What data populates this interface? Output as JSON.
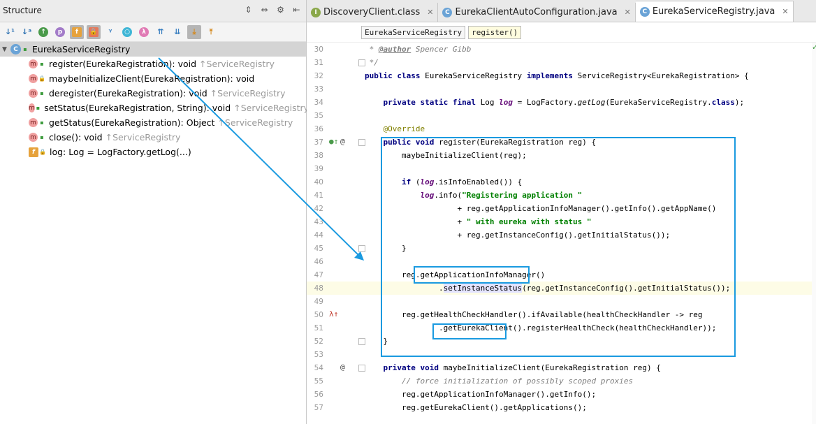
{
  "structure": {
    "title": "Structure",
    "root": "EurekaServiceRegistry",
    "items": [
      {
        "label": "register(EurekaRegistration): void",
        "inherited": "↑ServiceRegistry",
        "vis": "public",
        "kind": "method"
      },
      {
        "label": "maybeInitializeClient(EurekaRegistration): void",
        "inherited": "",
        "vis": "private",
        "kind": "method"
      },
      {
        "label": "deregister(EurekaRegistration): void",
        "inherited": "↑ServiceRegistry",
        "vis": "public",
        "kind": "method"
      },
      {
        "label": "setStatus(EurekaRegistration, String): void",
        "inherited": "↑ServiceRegistry",
        "vis": "public",
        "kind": "method"
      },
      {
        "label": "getStatus(EurekaRegistration): Object",
        "inherited": "↑ServiceRegistry",
        "vis": "public",
        "kind": "method"
      },
      {
        "label": "close(): void",
        "inherited": "↑ServiceRegistry",
        "vis": "public",
        "kind": "method"
      },
      {
        "label": "log: Log = LogFactory.getLog(...)",
        "inherited": "",
        "vis": "private",
        "kind": "field"
      }
    ]
  },
  "tabs": [
    {
      "label": "DiscoveryClient.class",
      "active": false
    },
    {
      "label": "EurekaClientAutoConfiguration.java",
      "active": false
    },
    {
      "label": "EurekaServiceRegistry.java",
      "active": true
    }
  ],
  "breadcrumbs": [
    "EurekaServiceRegistry",
    "register()"
  ],
  "code_lines": [
    "30",
    "31",
    "32",
    "33",
    "34",
    "35",
    "36",
    "37",
    "38",
    "39",
    "40",
    "41",
    "42",
    "43",
    "44",
    "45",
    "46",
    "47",
    "48",
    "49",
    "50",
    "51",
    "52",
    "53",
    "54",
    "55",
    "56",
    "57"
  ],
  "colors": {
    "annotation": "#1a9ae0",
    "keyword": "#000080",
    "string": "#008000"
  }
}
